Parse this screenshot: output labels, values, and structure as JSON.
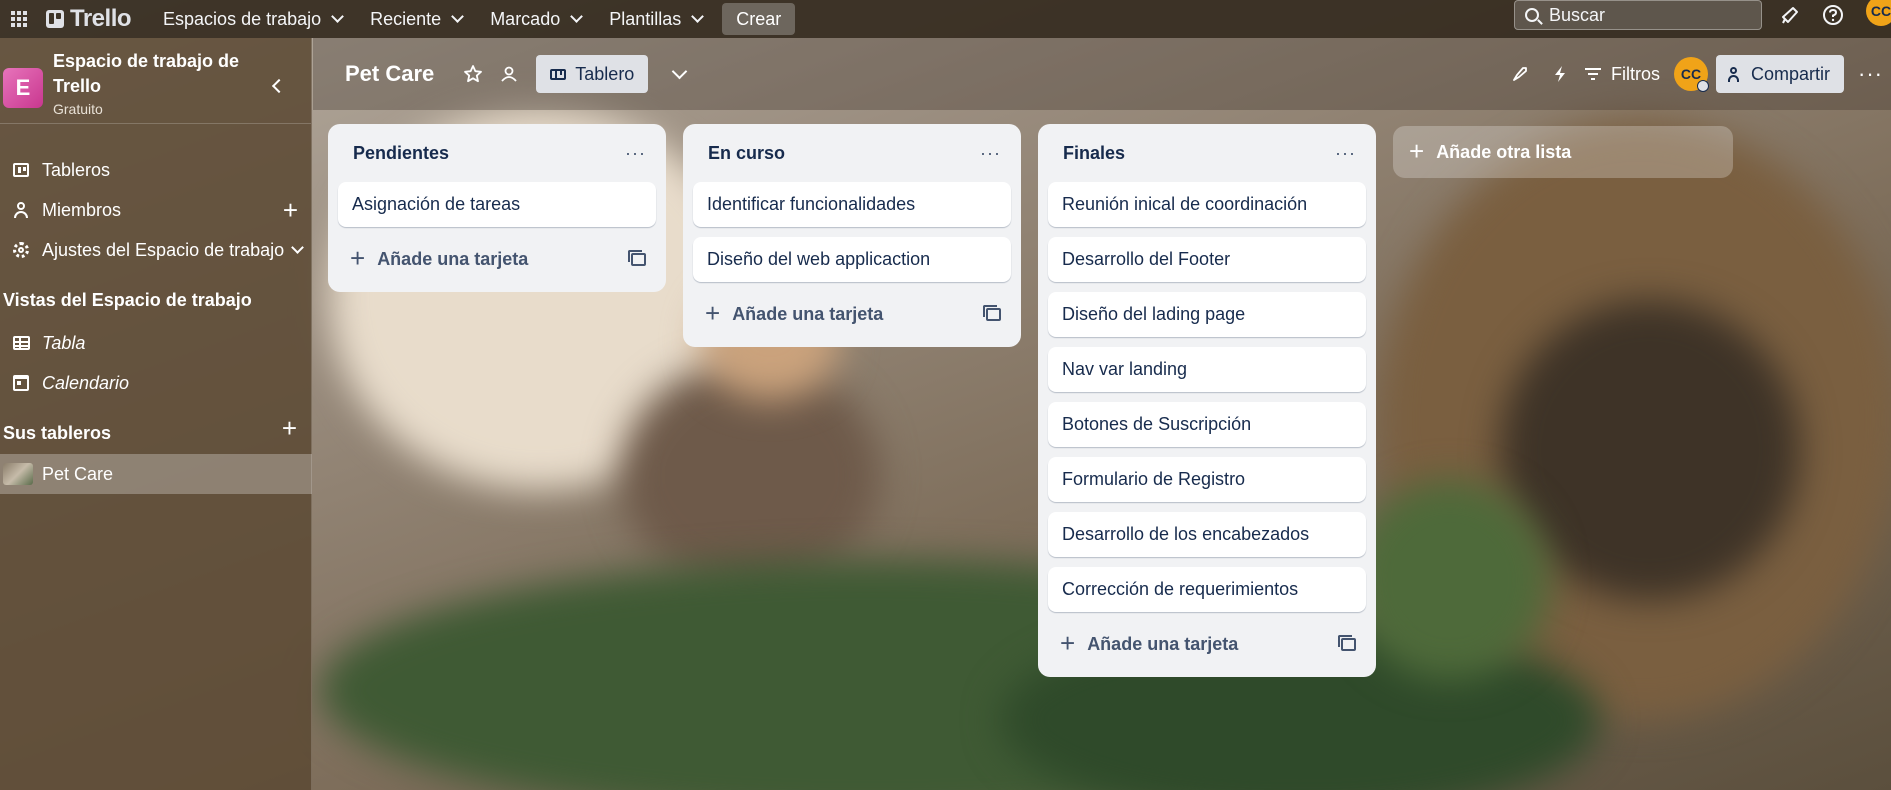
{
  "topbar": {
    "logo_text": "Trello",
    "nav": [
      "Espacios de trabajo",
      "Reciente",
      "Marcado",
      "Plantillas"
    ],
    "create_label": "Crear",
    "search_placeholder": "Buscar",
    "avatar_initials": "CC"
  },
  "sidebar": {
    "workspace_initial": "E",
    "workspace_name": "Espacio de trabajo de Trello",
    "workspace_plan": "Gratuito",
    "items": {
      "boards": "Tableros",
      "members": "Miembros",
      "settings": "Ajustes del Espacio de trabajo"
    },
    "views_title": "Vistas del Espacio de trabajo",
    "views": {
      "table": "Tabla",
      "calendar": "Calendario"
    },
    "your_boards_title": "Sus tableros",
    "active_board": "Pet Care"
  },
  "board": {
    "title": "Pet Care",
    "view_label": "Tablero",
    "filters_label": "Filtros",
    "share_label": "Compartir",
    "avatar_initials": "CC"
  },
  "lists": [
    {
      "title": "Pendientes",
      "cards": [
        "Asignación de tareas"
      ],
      "add_label": "Añade una tarjeta"
    },
    {
      "title": "En curso",
      "cards": [
        "Identificar funcionalidades",
        "Diseño del web applicaction"
      ],
      "add_label": "Añade una tarjeta"
    },
    {
      "title": "Finales",
      "cards": [
        "Reunión inical de coordinación",
        "Desarrollo del Footer",
        "Diseño del lading page",
        "Nav var landing",
        "Botones de Suscripción",
        "Formulario de Registro",
        "Desarrollo de los encabezados",
        "Corrección de requerimientos"
      ],
      "add_label": "Añade una tarjeta"
    }
  ],
  "add_list_label": "Añade otra lista"
}
